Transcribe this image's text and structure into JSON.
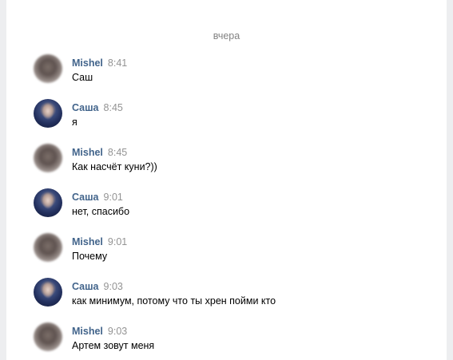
{
  "chat": {
    "date_divider": "вчера",
    "messages": [
      {
        "author": "Mishel",
        "time": "8:41",
        "text": "Саш",
        "avatar": "blurred-avatar"
      },
      {
        "author": "Саша",
        "time": "8:45",
        "text": "я",
        "avatar": "photo-avatar"
      },
      {
        "author": "Mishel",
        "time": "8:45",
        "text": "Как насчёт куни?))",
        "avatar": "blurred-avatar"
      },
      {
        "author": "Саша",
        "time": "9:01",
        "text": "нет, спасибо",
        "avatar": "photo-avatar"
      },
      {
        "author": "Mishel",
        "time": "9:01",
        "text": "Почему",
        "avatar": "blurred-avatar"
      },
      {
        "author": "Саша",
        "time": "9:03",
        "text": "как минимум, потому что ты хрен пойми кто",
        "avatar": "photo-avatar"
      },
      {
        "author": "Mishel",
        "time": "9:03",
        "text": "Артем зовут меня",
        "avatar": "blurred-avatar"
      }
    ]
  },
  "colors": {
    "author_link": "#42648b",
    "timestamp": "#939393",
    "background": "#edeef0",
    "panel": "#ffffff"
  }
}
